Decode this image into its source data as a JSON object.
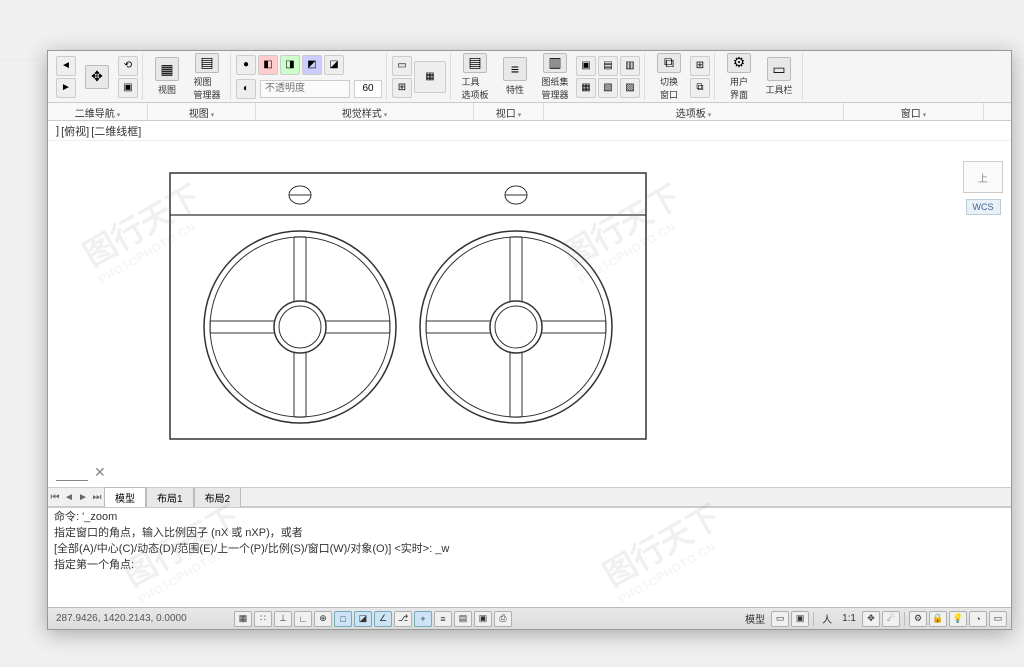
{
  "ribbon": {
    "view_btn": "视图",
    "view_mgr": "视图\n管理器",
    "tools_btn": "工具",
    "tools_panel": "工具\n选项板",
    "props": "特性",
    "sheets": "图纸集\n管理器",
    "switch_win": "切换\n窗口",
    "user_iface": "用户\n界面",
    "toolbar": "工具栏",
    "opacity_placeholder": "不透明度",
    "opacity_value": "60"
  },
  "panels": {
    "p1": "二维导航",
    "p2": "视图",
    "p3": "视觉样式",
    "p4": "视口",
    "p5": "选项板",
    "p6": "窗口"
  },
  "viewport": {
    "bracket_close": "]",
    "label1": "[俯视]",
    "label2": "[二维线框]",
    "cube_face": "上",
    "wcs": "WCS"
  },
  "tabs": {
    "model": "模型",
    "layout1": "布局1",
    "layout2": "布局2"
  },
  "command": {
    "l1": "命令: '_zoom",
    "l2": "指定窗口的角点，输入比例因子 (nX 或 nXP)，或者",
    "l3": "[全部(A)/中心(C)/动态(D)/范围(E)/上一个(P)/比例(S)/窗口(W)/对象(O)] <实时>:  _w",
    "l4": "指定第一个角点:"
  },
  "status": {
    "coords": "287.9426, 1420.2143, 0.0000",
    "model": "模型",
    "scale_prefix": "人",
    "scale": "1:1"
  },
  "watermark": {
    "brand": "图行天下",
    "url": "PHOTOPHOTO.CN"
  }
}
